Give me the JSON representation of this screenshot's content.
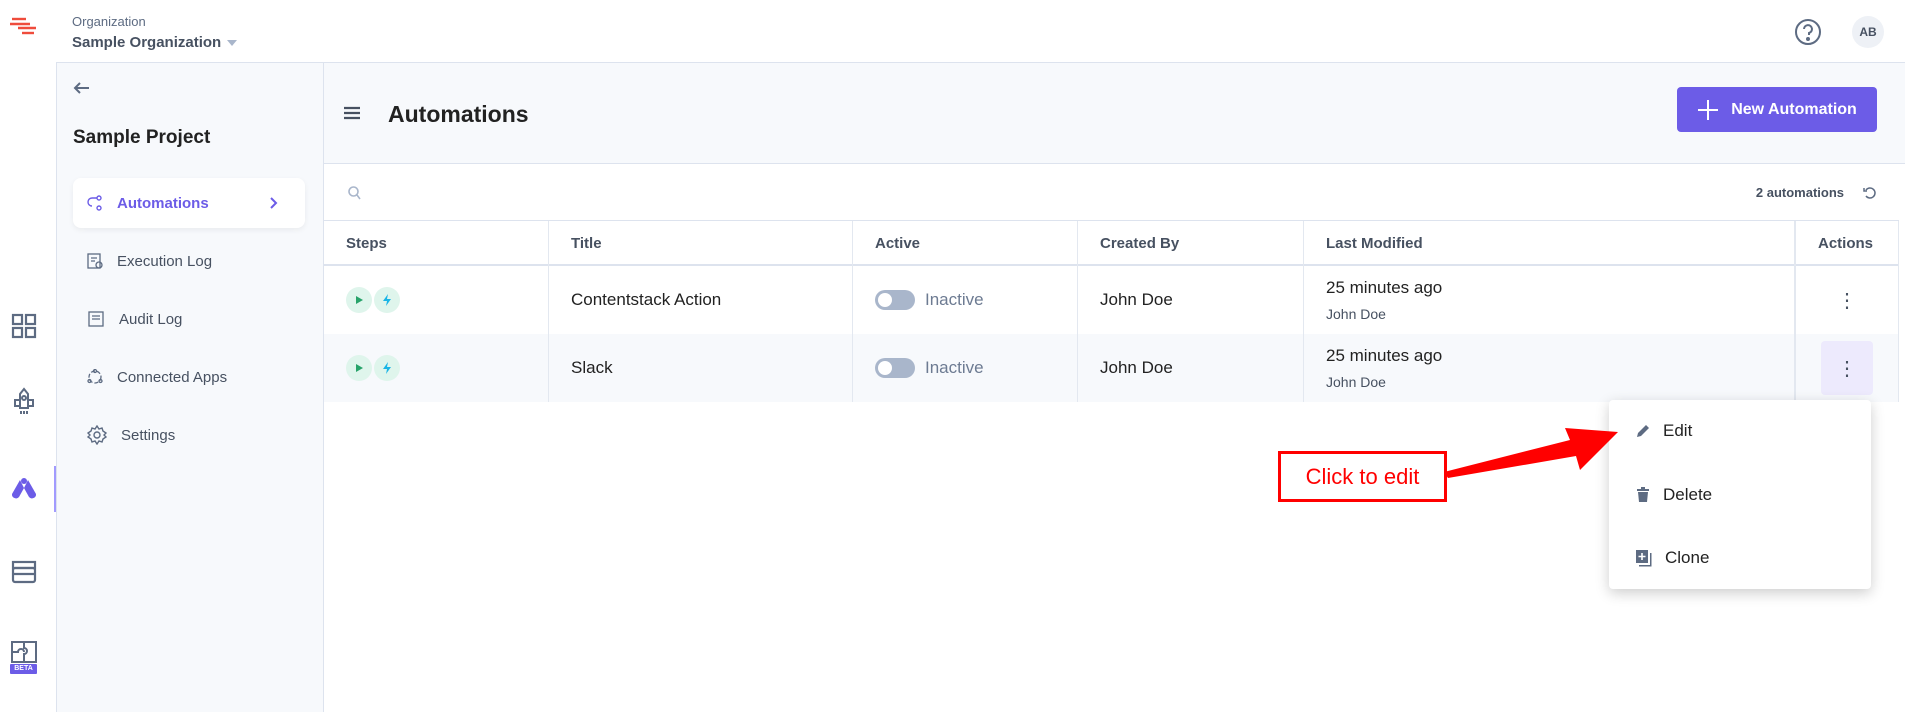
{
  "org": {
    "label": "Organization",
    "name": "Sample Organization"
  },
  "user": {
    "initials": "AB"
  },
  "sidebar": {
    "project": "Sample Project",
    "items": [
      {
        "label": "Automations"
      },
      {
        "label": "Execution Log"
      },
      {
        "label": "Audit Log"
      },
      {
        "label": "Connected Apps"
      },
      {
        "label": "Settings"
      }
    ]
  },
  "rail": {
    "beta_label": "BETA"
  },
  "page": {
    "title": "Automations",
    "new_button": "New Automation",
    "count": "2 automations"
  },
  "table": {
    "columns": [
      "Steps",
      "Title",
      "Active",
      "Created By",
      "Last Modified",
      "Actions"
    ],
    "rows": [
      {
        "title": "Contentstack Action",
        "active": "Inactive",
        "created_by": "John Doe",
        "modified": "25 minutes ago",
        "modified_by": "John Doe"
      },
      {
        "title": "Slack",
        "active": "Inactive",
        "created_by": "John Doe",
        "modified": "25 minutes ago",
        "modified_by": "John Doe"
      }
    ]
  },
  "menu": {
    "items": [
      "Edit",
      "Delete",
      "Clone"
    ]
  },
  "annotation": {
    "text": "Click to edit",
    "color": "#ff0000"
  },
  "colors": {
    "accent": "#6c5ce7"
  }
}
